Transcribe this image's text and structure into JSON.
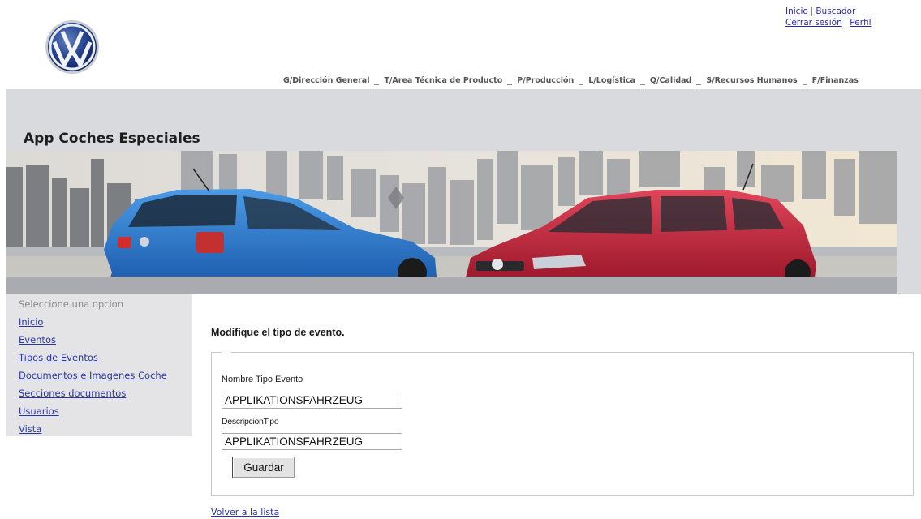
{
  "header": {
    "top_links": [
      {
        "label": "Inicio"
      },
      {
        "label": "Buscador"
      },
      {
        "label": "Cerrar sesión"
      },
      {
        "label": "Perfil"
      }
    ],
    "top_separator": "|",
    "departments": [
      "G/Dirección General",
      "T/Area Técnica de Producto",
      "P/Producción",
      "L/Logística",
      "Q/Calidad",
      "S/Recursos Humanos",
      "F/Finanzas"
    ]
  },
  "app_title": "App Coches Especiales",
  "sidebar": {
    "hint": "Seleccione una opcion",
    "items": [
      {
        "label": "Inicio"
      },
      {
        "label": "Eventos"
      },
      {
        "label": "Tipos de Eventos"
      },
      {
        "label": "Documentos e Imagenes Coche"
      },
      {
        "label": "Secciones documentos"
      },
      {
        "label": "Usuarios"
      },
      {
        "label": "Vista"
      }
    ]
  },
  "form": {
    "heading": "Modifique el tipo de evento.",
    "name_label": "Nombre Tipo Evento",
    "name_value": "APPLIKATIONSFAHRZEUG",
    "desc_label": "DescripcionTipo",
    "desc_value": "APPLIKATIONSFAHRZEUG",
    "save_label": "Guardar"
  },
  "back_link": "Volver a la lista",
  "colors": {
    "link": "#2a35a6",
    "band": "#d9dadd",
    "sidebar_bg": "#e4e4e6",
    "car_left": "#2f7fd0",
    "car_right": "#c8283c"
  },
  "icons": {
    "logo": "vw-logo-icon"
  }
}
